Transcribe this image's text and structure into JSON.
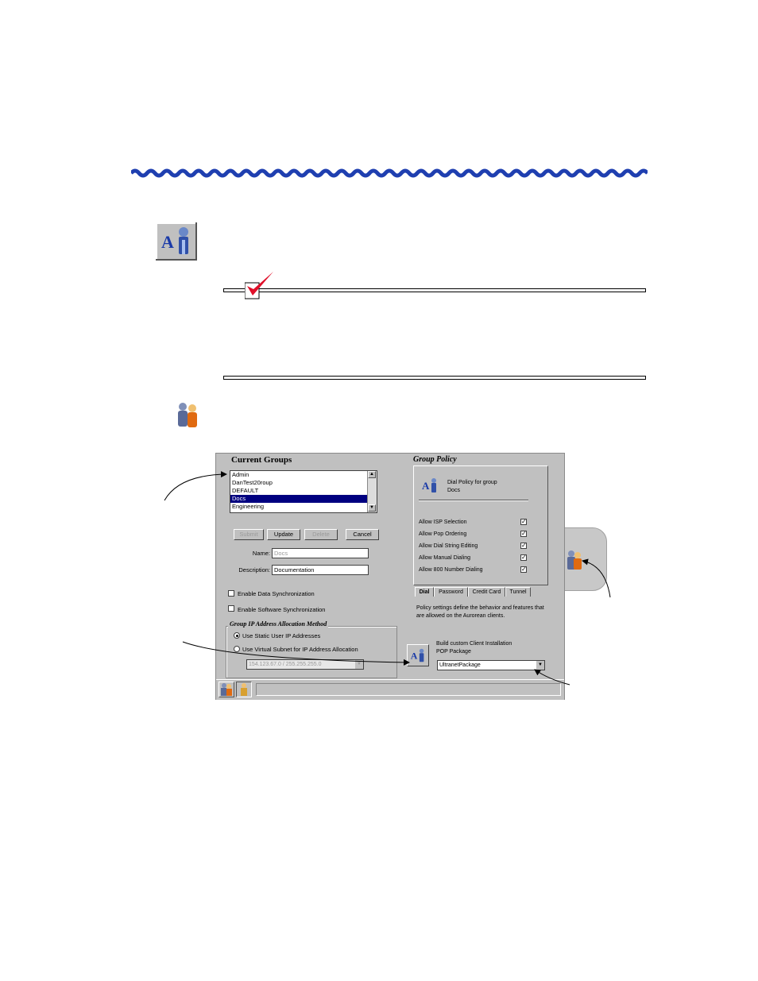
{
  "window": {
    "current_groups_title": "Current Groups",
    "groups": [
      "Admin",
      "DanTest20roup",
      "DEFAULT",
      "Docs",
      "Engineering"
    ],
    "selected_group": "Docs",
    "buttons": {
      "submit": "Submit",
      "update": "Update",
      "delete": "Delete",
      "cancel": "Cancel"
    },
    "name_label": "Name:",
    "name_value": "Docs",
    "description_label": "Description:",
    "description_value": "Documentation",
    "enable_data_sync": "Enable Data Synchronization",
    "enable_software_sync": "Enable Software Synchronization",
    "ip_alloc_title": "Group IP Address Allocation Method",
    "use_static": "Use Static User IP Addresses",
    "use_virtual_subnet": "Use Virtual Subnet for IP Address Allocation",
    "subnet_value": "154.123.67.0 / 255.255.255.0",
    "group_policy_title": "Group Policy",
    "dial_policy_line1": "Dial Policy for group",
    "dial_policy_line2": "Docs",
    "policies": [
      {
        "label": "Allow ISP Selection",
        "checked": true
      },
      {
        "label": "Allow Pop Ordering",
        "checked": true
      },
      {
        "label": "Allow Dial String Editing",
        "checked": true
      },
      {
        "label": "Allow Manual Dialing",
        "checked": true
      },
      {
        "label": "Allow 800 Number Dialing",
        "checked": true
      }
    ],
    "tabs": [
      "Dial",
      "Password",
      "Credit Card",
      "Tunnel"
    ],
    "policy_description": "Policy settings define the behavior and features that are allowed on the Aurorean clients.",
    "build_line1": "Build custom Client Installation",
    "build_line2": "POP Package",
    "package_value": "UltranetPackage",
    "check_mark": "✓"
  }
}
